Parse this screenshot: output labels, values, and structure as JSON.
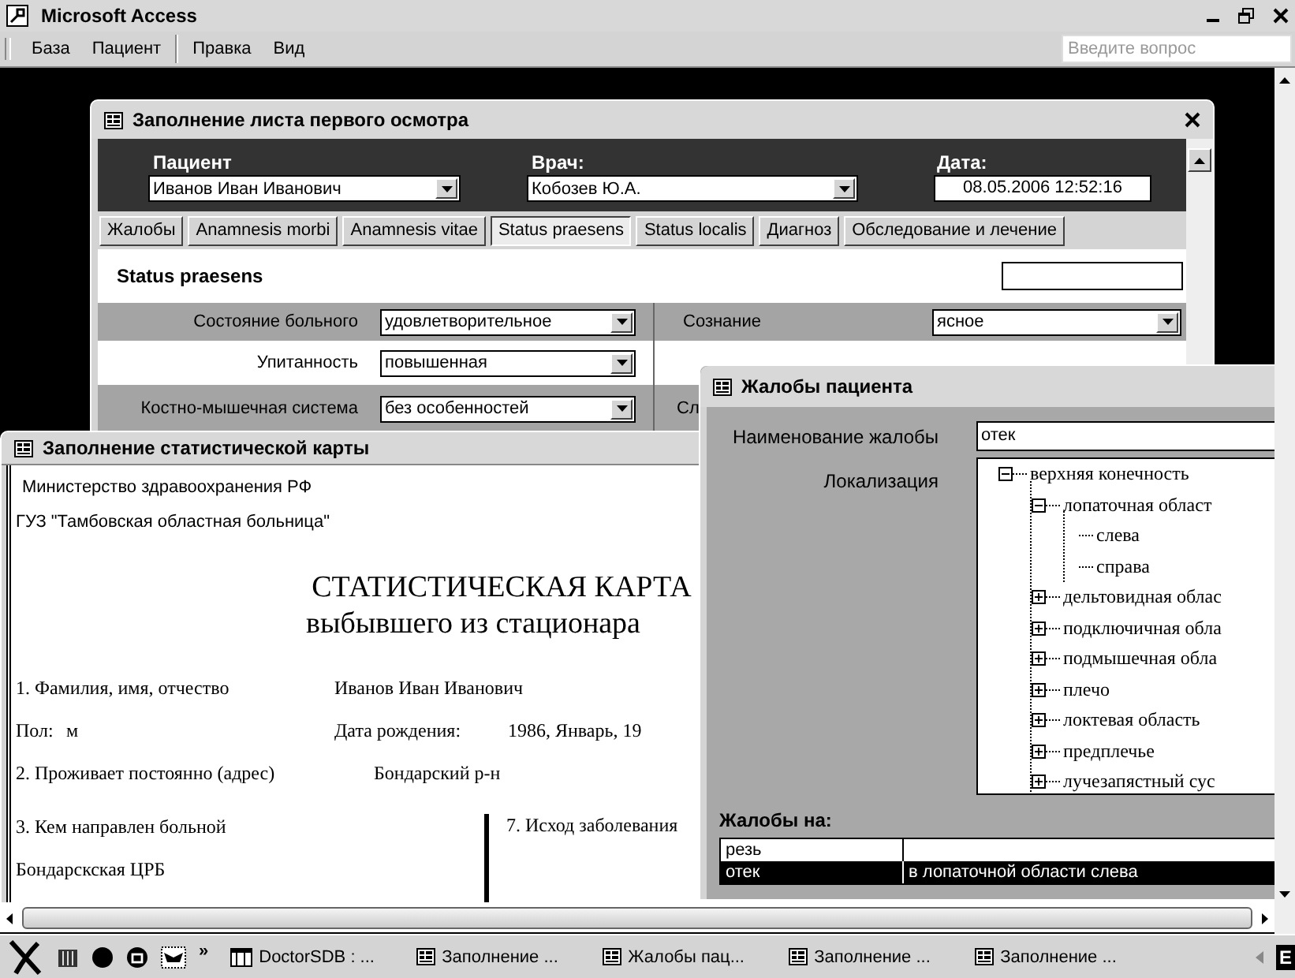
{
  "app": {
    "title": "Microsoft Access",
    "menu": [
      {
        "label": "База",
        "separator_before": false
      },
      {
        "label": "Пациент",
        "separator_before": false
      },
      {
        "label": "Правка",
        "separator_before": true
      },
      {
        "label": "Вид",
        "separator_before": false
      }
    ],
    "help": {
      "placeholder": "Введите вопрос"
    }
  },
  "exam_window": {
    "title": "Заполнение листа первого осмотра",
    "patient": {
      "label": "Пациент",
      "value": "Иванов Иван Иванович"
    },
    "doctor": {
      "label": "Врач:",
      "value": "Кобозев Ю.А."
    },
    "date": {
      "label": "Дата:",
      "value": "08.05.2006 12:52:16"
    },
    "tabs": [
      {
        "label": "Жалобы",
        "selected": false
      },
      {
        "label": "Anamnesis morbi",
        "selected": false
      },
      {
        "label": "Anamnesis vitae",
        "selected": false
      },
      {
        "label": "Status praesens",
        "selected": true
      },
      {
        "label": "Status localis",
        "selected": false
      },
      {
        "label": "Диагноз",
        "selected": false
      },
      {
        "label": "Обследование и лечение",
        "selected": false
      }
    ],
    "section_title": "Status praesens",
    "rows": [
      {
        "label": "Состояние больного",
        "value": "удовлетворительное",
        "right_label": "Сознание",
        "right_value": "ясное"
      },
      {
        "label": "Упитанность",
        "value": "повышенная"
      },
      {
        "label": "Костно-мышечная система",
        "value": "без особенностей",
        "right_label": "Сл"
      }
    ]
  },
  "stat_window": {
    "title": "Заполнение статистической карты",
    "institution": [
      "Министерство здравоохранения РФ",
      "ГУЗ \"Тамбовская областная больница\""
    ],
    "heading": [
      "СТАТИСТИЧЕСКАЯ КАРТА",
      "выбывшего из стационара"
    ],
    "fields": [
      {
        "label": "1. Фамилия, имя, отчество",
        "value": "Иванов Иван Иванович"
      },
      {
        "label": "Пол:",
        "value": "м"
      },
      {
        "label": "Дата рождения:",
        "value": "1986, Январь, 19"
      },
      {
        "label": "2. Проживает постоянно (адрес)",
        "value": "Бондарский р-н"
      }
    ],
    "referral": {
      "label": "3. Кем направлен больной",
      "value": "Бондарскская ЦРБ"
    },
    "outcome_label": "7. Исход заболевания"
  },
  "complaints_window": {
    "title": "Жалобы пациента",
    "name_label": "Наименование жалобы",
    "name_value": "отек",
    "location_label": "Локализация",
    "tree": [
      {
        "label": "верхняя конечность",
        "expanded": true,
        "children": [
          {
            "label": "лопаточная област",
            "expanded": true,
            "children": [
              {
                "label": "слева"
              },
              {
                "label": "справа"
              }
            ]
          },
          {
            "label": "дельтовидная облас",
            "expanded": false
          },
          {
            "label": "подключичная обла",
            "expanded": false
          },
          {
            "label": "подмышечная обла",
            "expanded": false
          },
          {
            "label": "плечо",
            "expanded": false
          },
          {
            "label": "локтевая область",
            "expanded": false
          },
          {
            "label": "предплечье",
            "expanded": false
          },
          {
            "label": "лучезапястный сус",
            "expanded": false
          }
        ]
      }
    ],
    "list_label": "Жалобы на:",
    "list_rows": [
      {
        "cells": [
          "резь",
          ""
        ],
        "selected": false
      },
      {
        "cells": [
          "отек",
          "в лопаточной области слева"
        ],
        "selected": true
      }
    ]
  },
  "taskbar": {
    "more": "»",
    "items": [
      {
        "label": "DoctorSDB : ...",
        "kind": "database"
      },
      {
        "label": "Заполнение ...",
        "kind": "form"
      },
      {
        "label": "Жалобы пац...",
        "kind": "form"
      },
      {
        "label": "Заполнение ...",
        "kind": "form"
      },
      {
        "label": "Заполнение ...",
        "kind": "form"
      }
    ],
    "language": "E"
  }
}
